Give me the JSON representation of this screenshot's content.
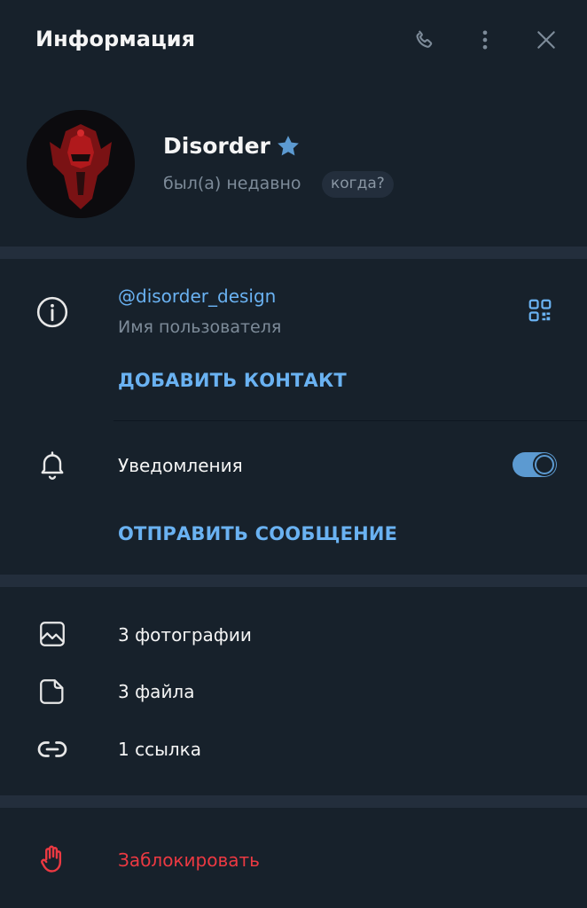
{
  "header": {
    "title": "Информация"
  },
  "profile": {
    "name": "Disorder",
    "status": "был(а) недавно",
    "when_badge": "когда?"
  },
  "info": {
    "username": "@disorder_design",
    "username_caption": "Имя пользователя",
    "add_contact": "ДОБАВИТЬ КОНТАКТ"
  },
  "notifications": {
    "label": "Уведомления",
    "enabled": true,
    "send_message": "ОТПРАВИТЬ СООБЩЕНИЕ"
  },
  "media": {
    "photos": "3 фотографии",
    "files": "3 файла",
    "links": "1 ссылка"
  },
  "block": {
    "label": "Заблокировать"
  },
  "colors": {
    "background": "#17212b",
    "separator": "#232e3c",
    "accent": "#6ab2f2",
    "danger": "#ec3942",
    "toggle": "#5c9ad1"
  }
}
